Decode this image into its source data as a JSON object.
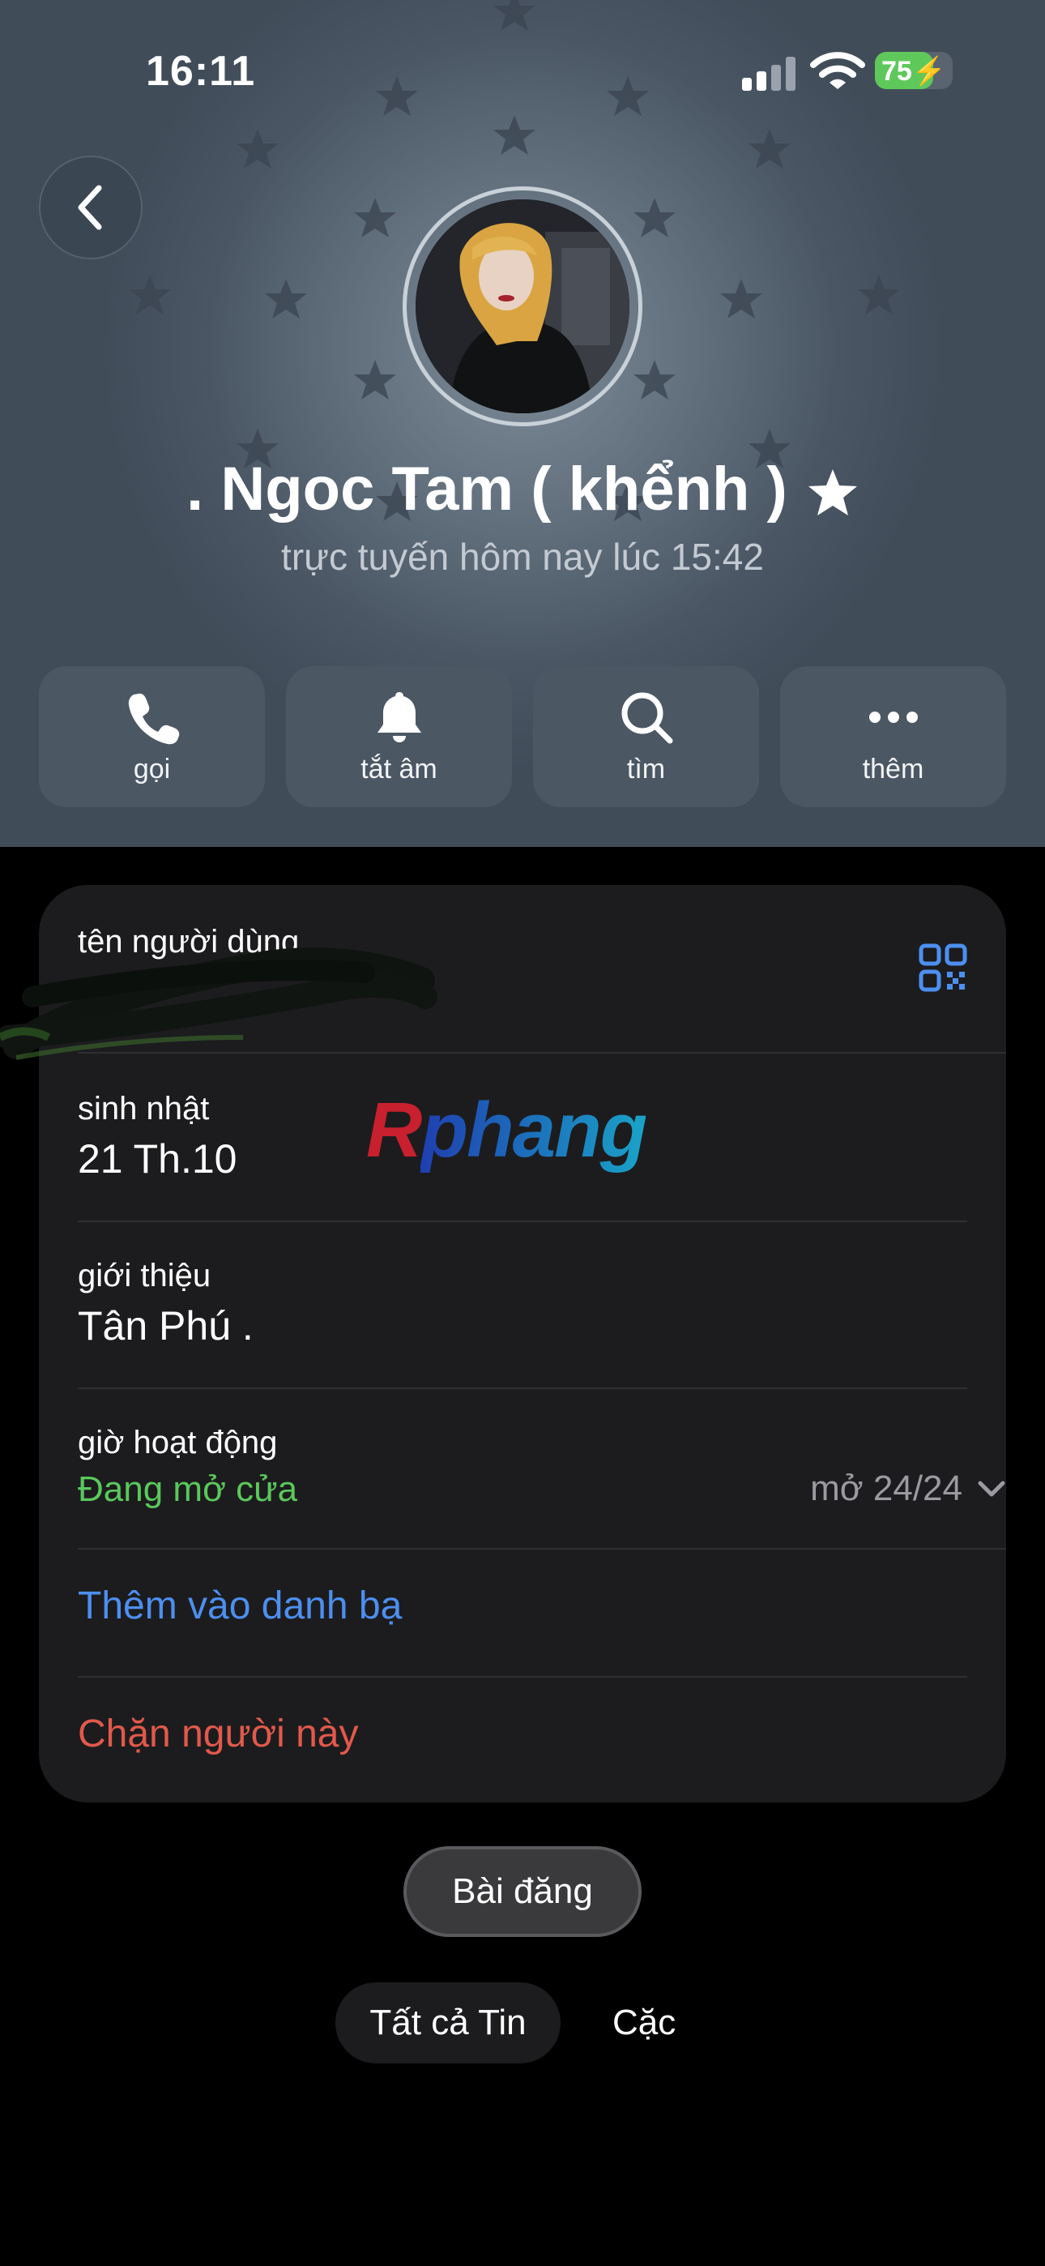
{
  "status_bar": {
    "time": "16:11",
    "battery_percent": 75,
    "battery_label": "75"
  },
  "profile": {
    "name": ". Ngoc Tam ( khểnh )",
    "last_seen": "trực tuyến hôm nay lúc 15:42"
  },
  "actions": [
    {
      "label": "gọi",
      "icon": "phone-icon"
    },
    {
      "label": "tắt âm",
      "icon": "bell-icon"
    },
    {
      "label": "tìm",
      "icon": "search-icon"
    },
    {
      "label": "thêm",
      "icon": "more-icon"
    }
  ],
  "info": {
    "username_label": "tên người dùng",
    "birthday_label": "sinh nhật",
    "birthday_value": "21 Th.10",
    "bio_label": "giới thiệu",
    "bio_value": "Tân Phú .",
    "hours_label": "giờ hoạt động",
    "hours_status": "Đang mở cửa",
    "hours_value": "mở 24/24",
    "add_contact": "Thêm vào danh bạ",
    "block": "Chặn người này"
  },
  "watermark": "Rphang",
  "posts_button": "Bài đăng",
  "tabs": {
    "all": "Tất cả Tin",
    "other": "Cặc"
  },
  "colors": {
    "green": "#5ac85c",
    "blue": "#4d8ff0",
    "red": "#e2594b",
    "card": "#1c1c1e"
  }
}
